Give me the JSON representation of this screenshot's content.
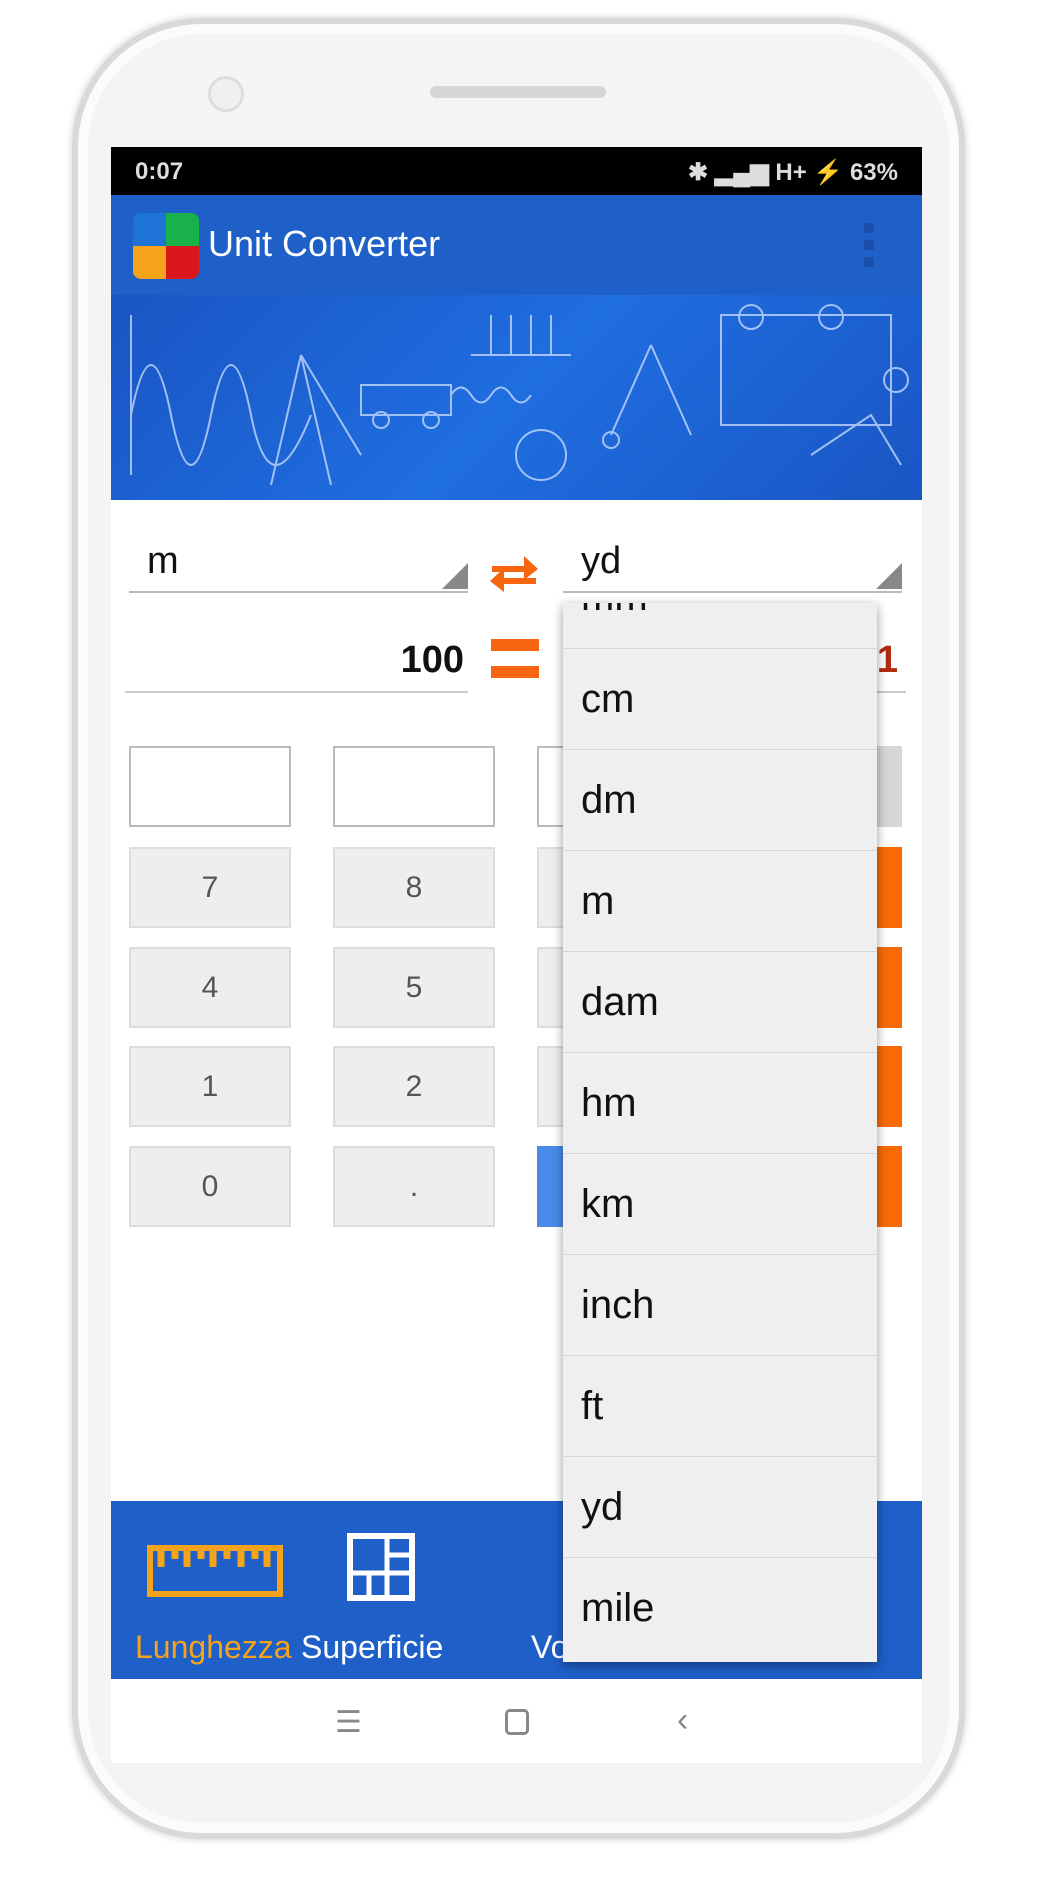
{
  "status_bar": {
    "time": "0:07",
    "indicators": "✱ ▂▄▆ H+ ⚡",
    "battery": "63%"
  },
  "app_bar": {
    "title": "Unit Converter",
    "menu_icon": "overflow-menu-icon"
  },
  "converter": {
    "from_unit": "m",
    "to_unit": "yd",
    "input_value": "100",
    "output_value_visible": "1",
    "swap_icon": "swap-arrows-icon",
    "equals_icon": "equals-icon",
    "accent": "#f7650f",
    "result_color": "#b22a10"
  },
  "keypad": {
    "keys": [
      "7",
      "8",
      "4",
      "5",
      "1",
      "2",
      "0",
      "."
    ]
  },
  "dropdown": {
    "options": [
      "mm",
      "cm",
      "dm",
      "m",
      "dam",
      "hm",
      "km",
      "inch",
      "ft",
      "yd",
      "mile"
    ]
  },
  "bottom_nav": {
    "items": [
      {
        "label": "Lunghezza",
        "icon": "ruler-icon",
        "active": true
      },
      {
        "label": "Superficie",
        "icon": "area-grid-icon"
      },
      {
        "label": "Vo",
        "icon": "volume-icon"
      }
    ],
    "active_color": "#f5a31a",
    "bar_color": "#1e5fc8"
  }
}
